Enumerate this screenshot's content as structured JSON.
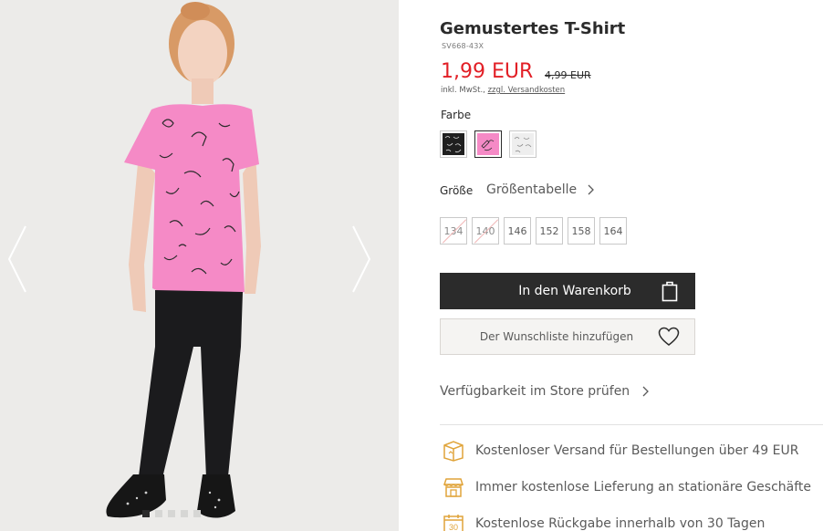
{
  "product": {
    "title": "Gemustertes T-Shirt",
    "sku": "SV668-43X",
    "price": "1,99 EUR",
    "old_price": "4,99 EUR",
    "tax_note": "inkl. MwSt., ",
    "shipping_link": "zzgl. Versandkosten"
  },
  "color": {
    "label": "Farbe",
    "swatches": [
      {
        "name": "black-print",
        "color": "#1f1f1f"
      },
      {
        "name": "pink-print",
        "color": "#f58ac6"
      },
      {
        "name": "white-print",
        "color": "#eeeeee"
      }
    ]
  },
  "size": {
    "label": "Größe",
    "guide_label": "Größentabelle",
    "options": [
      "134",
      "140",
      "146",
      "152",
      "158",
      "164"
    ]
  },
  "actions": {
    "cart_label": "In den Warenkorb",
    "wishlist_label": "Der Wunschliste hinzufügen",
    "store_label": "Verfügbarkeit im Store prüfen"
  },
  "benefits": [
    {
      "icon": "shipping-box-icon",
      "text": "Kostenloser Versand für Bestellungen über 49 EUR"
    },
    {
      "icon": "store-icon",
      "text": "Immer kostenlose Lieferung an stationäre Geschäfte"
    },
    {
      "icon": "calendar-30-icon",
      "text": "Kostenlose Rückgabe innerhalb von 30 Tagen",
      "icon_text": "30"
    }
  ],
  "colors": {
    "price_red": "#e21f26",
    "cart_button": "#2b2b2b",
    "benefit_icon": "#e0a43a",
    "shirt_pink": "#f58ac6"
  }
}
